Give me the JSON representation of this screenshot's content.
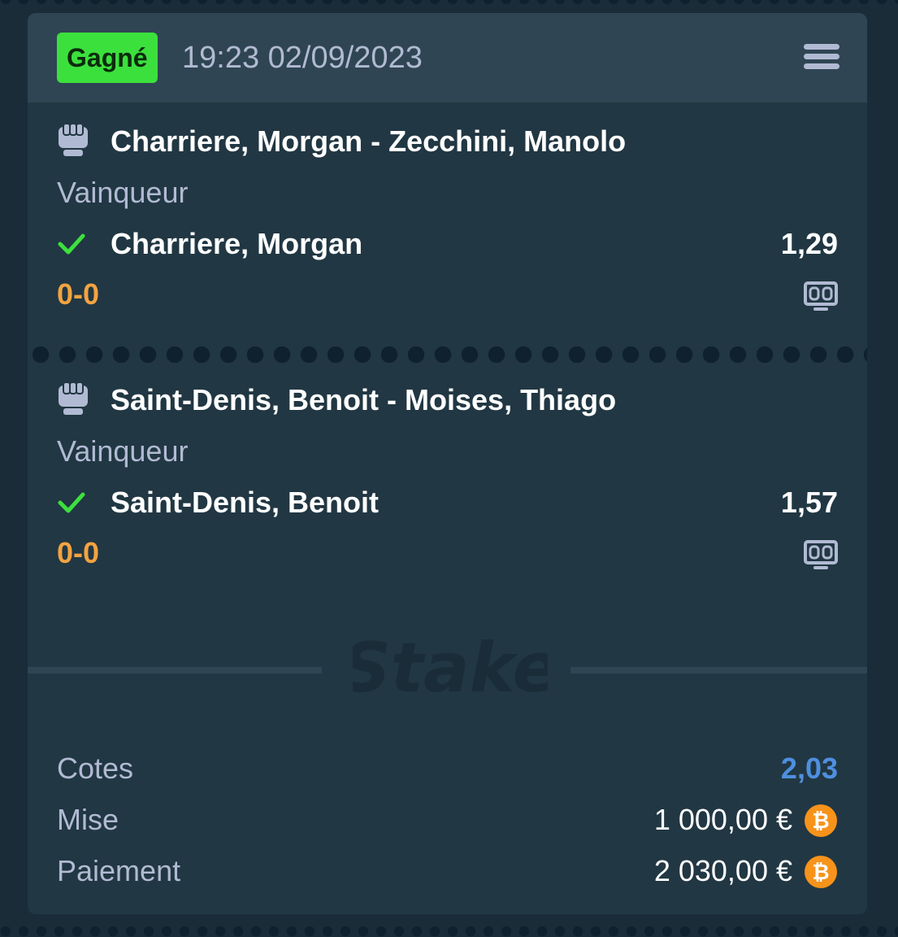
{
  "header": {
    "status_badge": "Gagné",
    "datetime": "19:23 02/09/2023",
    "menu_icon": "menu-icon"
  },
  "legs": [
    {
      "event": "Charriere, Morgan - Zecchini, Manolo",
      "market": "Vainqueur",
      "selection": "Charriere, Morgan",
      "odds": "1,29",
      "score": "0-0",
      "sport_icon": "fist-icon",
      "status_icon": "check-icon"
    },
    {
      "event": "Saint-Denis, Benoit - Moises, Thiago",
      "market": "Vainqueur",
      "selection": "Saint-Denis, Benoit",
      "odds": "1,57",
      "score": "0-0",
      "sport_icon": "fist-icon",
      "status_icon": "check-icon"
    }
  ],
  "brand": {
    "logo_text": "Stake"
  },
  "summary": {
    "odds_label": "Cotes",
    "odds_value": "2,03",
    "stake_label": "Mise",
    "stake_value": "1 000,00 €",
    "payout_label": "Paiement",
    "payout_value": "2 030,00 €",
    "currency_icon": "bitcoin-icon"
  },
  "colors": {
    "win_badge": "#3ce03d",
    "score": "#f2a341",
    "total_odds": "#4f8fe0",
    "card_bg": "#213743",
    "header_bg": "#2f4553",
    "bitcoin": "#f7931a"
  }
}
